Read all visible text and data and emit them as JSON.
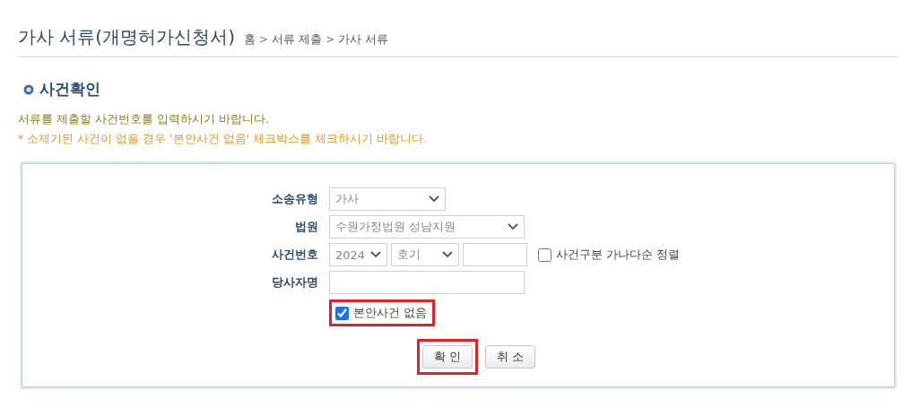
{
  "page": {
    "title": "가사 서류(개명허가신청서)",
    "breadcrumb": [
      "홈",
      "서류 제출",
      "가사 서류"
    ],
    "breadcrumb_separator": ">"
  },
  "section": {
    "heading": "사건확인",
    "notes": [
      {
        "text": "서류를 제출할 사건번호를 입력하시기 바랍니다.",
        "kind": "info"
      },
      {
        "text": "* 소제기된 사건이 없을 경우 '본안사건 없음' 체크박스를 체크하시기 바랍니다.",
        "kind": "warning"
      }
    ]
  },
  "form": {
    "rows": [
      {
        "label": "소송유형",
        "fields": [
          {
            "kind": "select",
            "value": "가사"
          }
        ]
      },
      {
        "label": "법원",
        "fields": [
          {
            "kind": "select",
            "value": "수원가정법원 성남지원"
          }
        ]
      },
      {
        "label": "사건번호",
        "fields": [
          {
            "kind": "select",
            "value": "2024"
          },
          {
            "kind": "select",
            "value": "호기"
          },
          {
            "kind": "input"
          },
          {
            "kind": "checkbox",
            "label": "사건구분 가나다순 정렬",
            "checked": false
          }
        ]
      },
      {
        "label": "당사자명",
        "fields": [
          {
            "kind": "input"
          }
        ]
      }
    ],
    "no_case": {
      "label": "본안사건 없음",
      "checked": true,
      "highlighted": true
    },
    "buttons": [
      {
        "label": "확 인",
        "highlighted": true
      },
      {
        "label": "취 소",
        "highlighted": false
      }
    ]
  }
}
